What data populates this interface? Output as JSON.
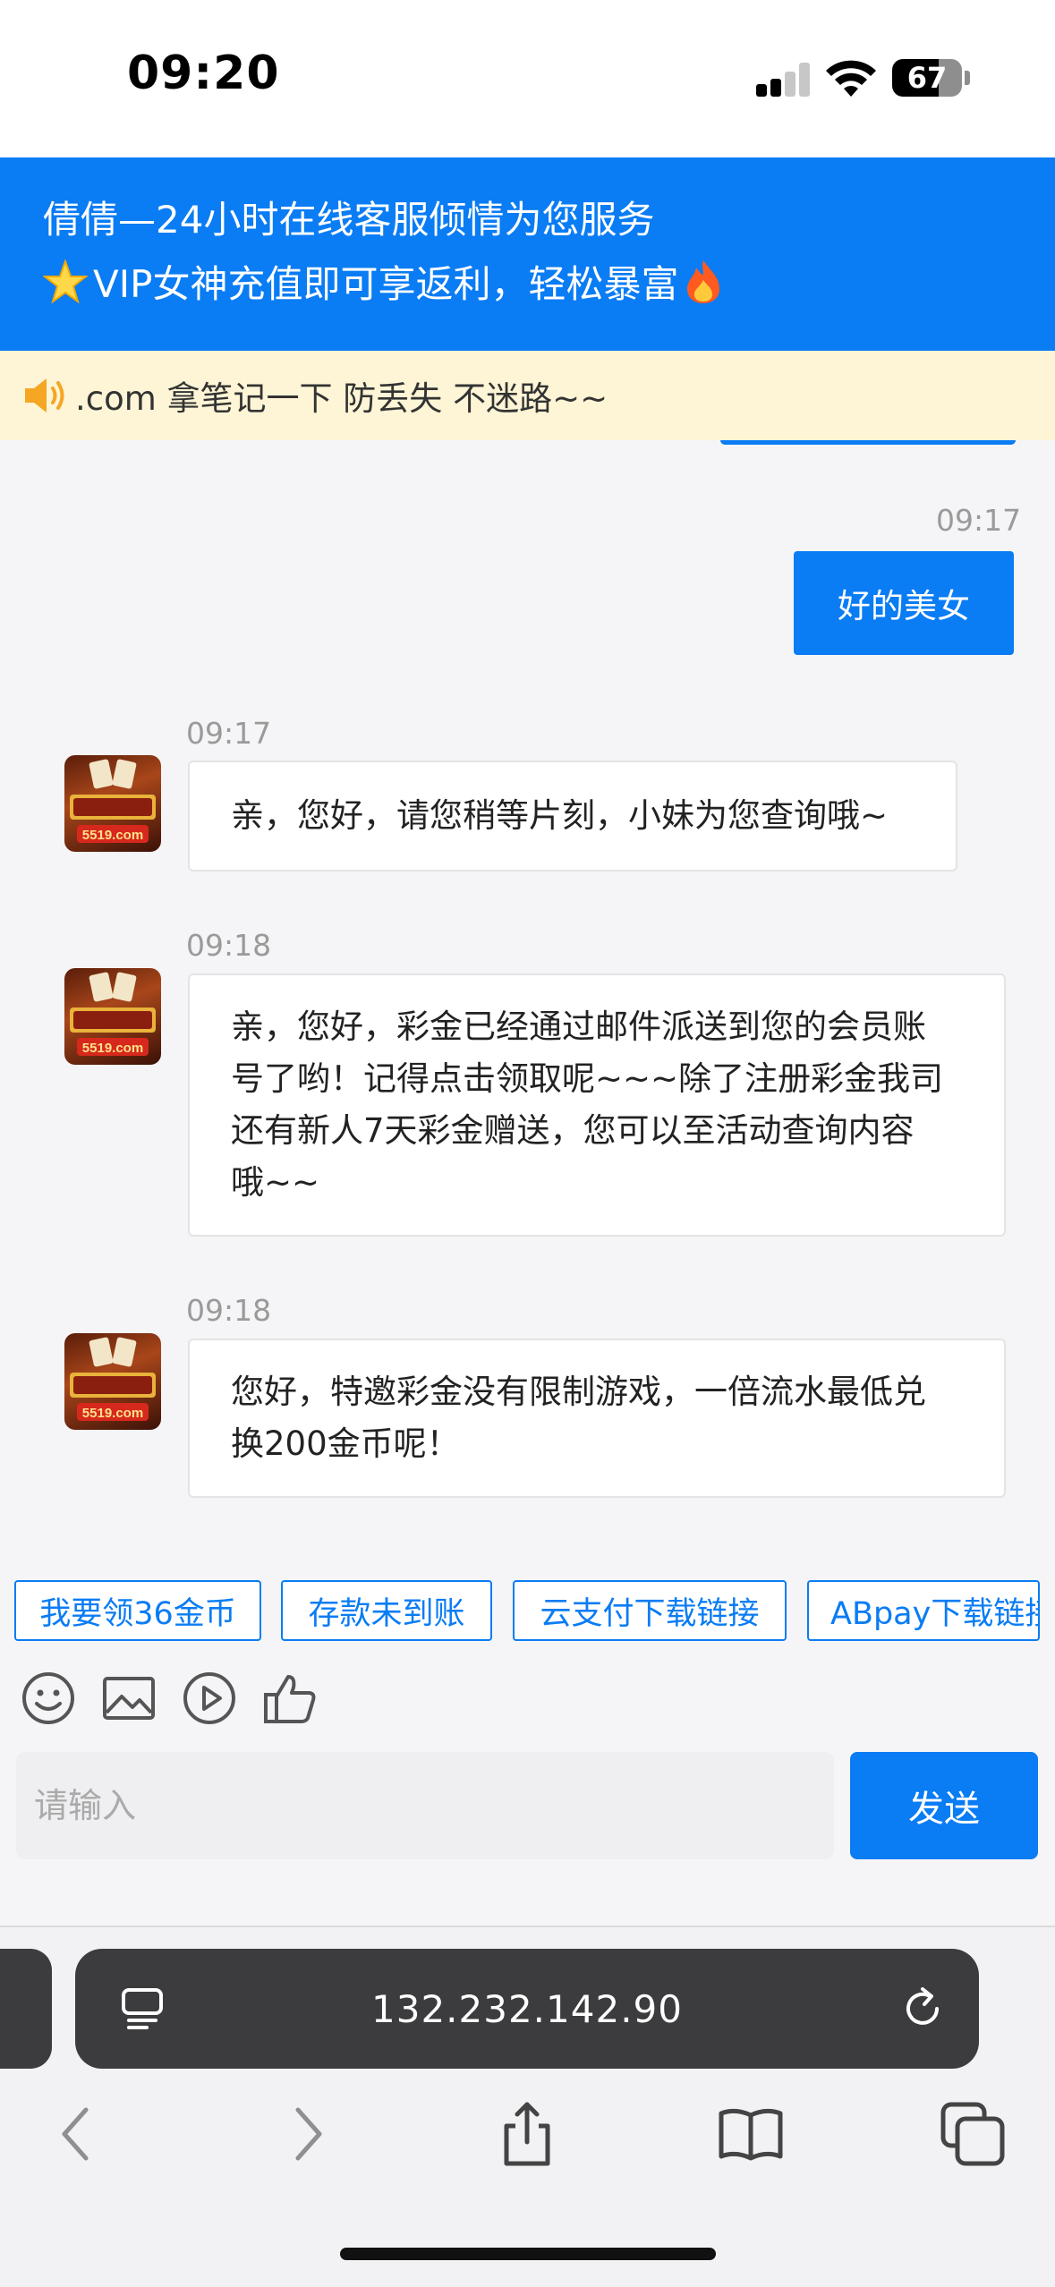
{
  "status_bar": {
    "time": "09:20",
    "battery": "67",
    "battery_level": 0.67
  },
  "header": {
    "line1": "倩倩—24小时在线客服倾情为您服务",
    "line2_icon": "star-icon",
    "line2_text": "VIP女神充值即可享返利，轻松暴富",
    "line2_trailing_icon": "fire-icon"
  },
  "notice": {
    "icon": "speaker-icon",
    "text": ".com 拿笔记一下 防丢失 不迷路~~"
  },
  "messages": [
    {
      "direction": "outgoing",
      "time": "09:17",
      "text": "好的美女"
    },
    {
      "direction": "incoming",
      "time": "09:17",
      "avatar_text": "5519.com",
      "text": "亲，您好，请您稍等片刻，小妹为您查询哦~"
    },
    {
      "direction": "incoming",
      "time": "09:18",
      "avatar_text": "5519.com",
      "text_lines": [
        "亲，您好，彩金已经通过邮件派送到您的会员账",
        "号了哟！记得点击领取呢~~~除了注册彩金我司",
        "还有新人7天彩金赠送，您可以至活动查询内容",
        "哦~~"
      ]
    },
    {
      "direction": "incoming",
      "time": "09:18",
      "avatar_text": "5519.com",
      "text_lines": [
        "您好，特邀彩金没有限制游戏，一倍流水最低兑",
        "换200金币呢！"
      ]
    }
  ],
  "quick_replies": [
    "我要领36金币",
    "存款未到账",
    "云支付下载链接",
    "ABpay下载链接"
  ],
  "tools": [
    "emoji-icon",
    "image-icon",
    "video-icon",
    "thumbs-up-icon"
  ],
  "composer": {
    "placeholder": "请输入",
    "send_label": "发送"
  },
  "browser": {
    "url": "132.232.142.90",
    "nav": [
      "back-icon",
      "forward-icon",
      "share-icon",
      "bookmarks-icon",
      "tabs-icon"
    ]
  },
  "colors": {
    "accent": "#0a7cf4",
    "notice_bg": "#fdf5d6",
    "chat_bg": "#f5f5f7"
  }
}
